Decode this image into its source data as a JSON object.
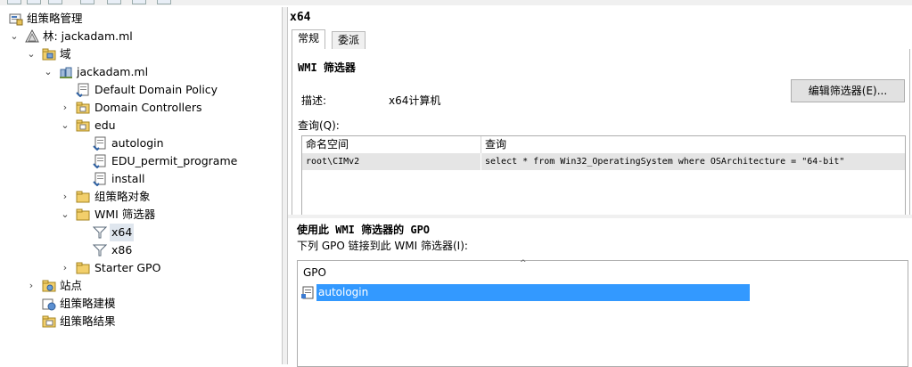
{
  "tree": {
    "root": {
      "label": "组策略管理",
      "icon": "gpmc-console-icon"
    },
    "forest": {
      "label": "林: jackadam.ml",
      "icon": "forest-icon"
    },
    "domains": {
      "label": "域",
      "icon": "domains-folder-icon"
    },
    "domain": {
      "label": "jackadam.ml",
      "icon": "domain-icon"
    },
    "default_policy": {
      "label": "Default Domain Policy",
      "icon": "gpo-link-icon"
    },
    "domain_controllers": {
      "label": "Domain Controllers",
      "icon": "ou-icon"
    },
    "edu": {
      "label": "edu",
      "icon": "ou-icon"
    },
    "edu_autologin": {
      "label": "autologin",
      "icon": "gpo-link-icon"
    },
    "edu_permit": {
      "label": "EDU_permit_programe",
      "icon": "gpo-link-icon"
    },
    "edu_install": {
      "label": "install",
      "icon": "gpo-link-icon"
    },
    "gpo_objects": {
      "label": "组策略对象",
      "icon": "folder-icon"
    },
    "wmi_filters": {
      "label": "WMI 筛选器",
      "icon": "folder-icon"
    },
    "x64": {
      "label": "x64",
      "icon": "wmi-filter-icon"
    },
    "x86": {
      "label": "x86",
      "icon": "wmi-filter-icon"
    },
    "starter_gpo": {
      "label": "Starter GPO",
      "icon": "folder-icon"
    },
    "sites": {
      "label": "站点",
      "icon": "sites-icon"
    },
    "modeling": {
      "label": "组策略建模",
      "icon": "modeling-icon"
    },
    "results": {
      "label": "组策略结果",
      "icon": "results-icon"
    }
  },
  "detail": {
    "title": "x64",
    "tabs": [
      {
        "label": "常规"
      },
      {
        "label": "委派"
      }
    ],
    "section_wmi": "WMI 筛选器",
    "desc_label": "描述:",
    "desc_value": "x64计算机",
    "edit_button": "编辑筛选器(E)...",
    "query_label": "查询(Q):",
    "query_columns": [
      "命名空间",
      "查询"
    ],
    "query_rows": [
      {
        "namespace": "root\\CIMv2",
        "query": "select * from Win32_OperatingSystem where OSArchitecture = \"64-bit\""
      }
    ],
    "section_gpo": "使用此 WMI 筛选器的 GPO",
    "gpo_list_label": "下列 GPO 链接到此 WMI 筛选器(I):",
    "gpo_column": "GPO",
    "gpo_rows": [
      {
        "name": "autologin"
      }
    ]
  },
  "colors": {
    "selection": "#3399ff",
    "tree_selection": "#dfe6ee"
  }
}
